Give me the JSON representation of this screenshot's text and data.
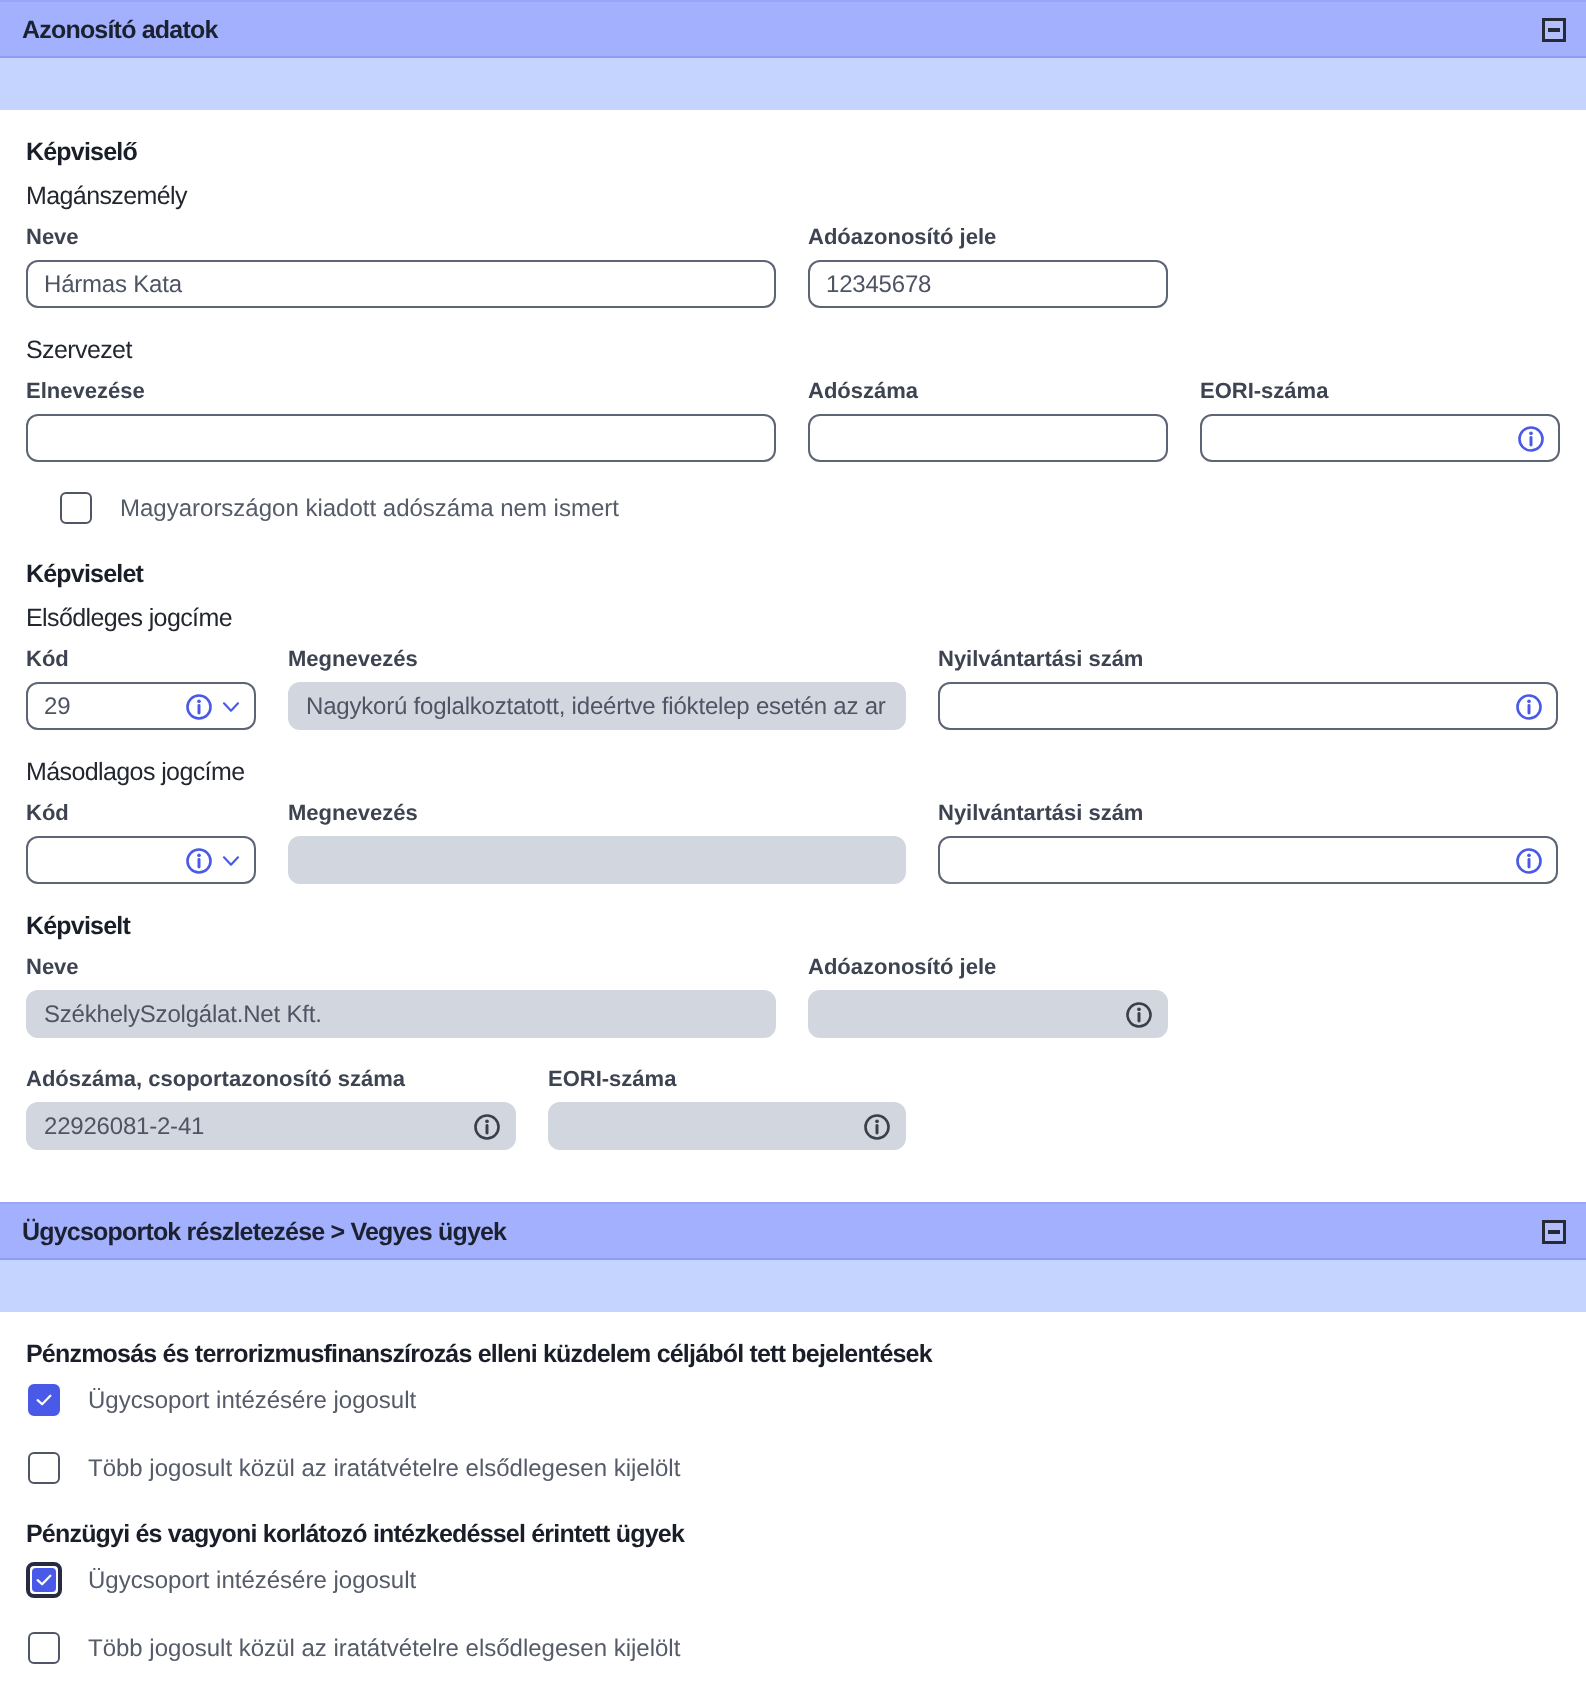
{
  "sections": [
    {
      "title": "Azonosító adatok",
      "expanded": true,
      "blocks": [
        {
          "kind": "heading",
          "text": "Képviselő"
        },
        {
          "kind": "subheading",
          "text": "Magánszemély"
        },
        {
          "kind": "fields",
          "fields": [
            {
              "kind": "text",
              "label": "Neve",
              "value": "Hármas Kata",
              "disabled": false,
              "info": false
            },
            {
              "kind": "text",
              "label": "Adóazonosító jele",
              "value": "12345678",
              "disabled": false,
              "info": false
            }
          ]
        },
        {
          "kind": "subheading",
          "text": "Szervezet"
        },
        {
          "kind": "fields",
          "fields": [
            {
              "kind": "text",
              "label": "Elnevezése",
              "disabled": false,
              "info": false
            },
            {
              "kind": "text",
              "label": "Adószáma",
              "disabled": false,
              "info": false
            },
            {
              "kind": "text",
              "label": "EORI-száma",
              "disabled": false,
              "info": true
            }
          ],
          "option": {
            "label": "Magyarországon kiadott adószáma nem ismert",
            "checked": false,
            "focused": false
          }
        },
        {
          "kind": "heading",
          "text": "Képviselet"
        },
        {
          "kind": "subheading",
          "text": "Elsődleges jogcíme"
        },
        {
          "kind": "fields",
          "fields": [
            {
              "kind": "select",
              "label": "Kód",
              "value": "29",
              "disabled": false,
              "info": true
            },
            {
              "kind": "text",
              "label": "Megnevezés",
              "value": "Nagykorú foglalkoztatott, ideértve fióktelep esetén az ar",
              "disabled": true,
              "info": false
            },
            {
              "kind": "text",
              "label": "Nyilvántartási szám",
              "disabled": false,
              "info": true
            }
          ]
        },
        {
          "kind": "subheading",
          "text": "Másodlagos jogcíme"
        },
        {
          "kind": "fields",
          "fields": [
            {
              "kind": "select",
              "label": "Kód",
              "disabled": false,
              "info": true
            },
            {
              "kind": "text",
              "label": "Megnevezés",
              "disabled": true,
              "info": false
            },
            {
              "kind": "text",
              "label": "Nyilvántartási szám",
              "disabled": false,
              "info": true
            }
          ]
        },
        {
          "kind": "heading",
          "text": "Képviselt"
        },
        {
          "kind": "fields",
          "fields": [
            {
              "kind": "text",
              "label": "Neve",
              "value": "SzékhelySzolgálat.Net Kft.",
              "disabled": true,
              "info": false
            },
            {
              "kind": "text",
              "label": "Adóazonosító jele",
              "disabled": true,
              "info": true
            }
          ]
        },
        {
          "kind": "fields",
          "fields": [
            {
              "kind": "text",
              "label": "Adószáma, csoportazonosító száma",
              "value": "22926081-2-41",
              "disabled": true,
              "info": true
            },
            {
              "kind": "text",
              "label": "EORI-száma",
              "disabled": true,
              "info": true
            }
          ]
        }
      ]
    },
    {
      "title": "Ügycsoportok részletezése > Vegyes ügyek",
      "expanded": true,
      "blocks": [
        {
          "kind": "heading",
          "text": "Pénzmosás és terrorizmusfinanszírozás elleni küzdelem céljából tett bejelentések"
        },
        {
          "kind": "checkbox",
          "label": "Ügycsoport intézésére jogosult",
          "checked": true,
          "focused": false
        },
        {
          "kind": "checkbox",
          "label": "Több jogosult közül az iratátvételre elsődlegesen kijelölt",
          "checked": false,
          "focused": false
        },
        {
          "kind": "heading",
          "text": "Pénzügyi és vagyoni korlátozó intézkedéssel érintett ügyek"
        },
        {
          "kind": "checkbox",
          "label": "Ügycsoport intézésére jogosult",
          "checked": true,
          "focused": true
        },
        {
          "kind": "checkbox",
          "label": "Több jogosult közül az iratátvételre elsődlegesen kijelölt",
          "checked": false,
          "focused": false
        }
      ]
    }
  ]
}
